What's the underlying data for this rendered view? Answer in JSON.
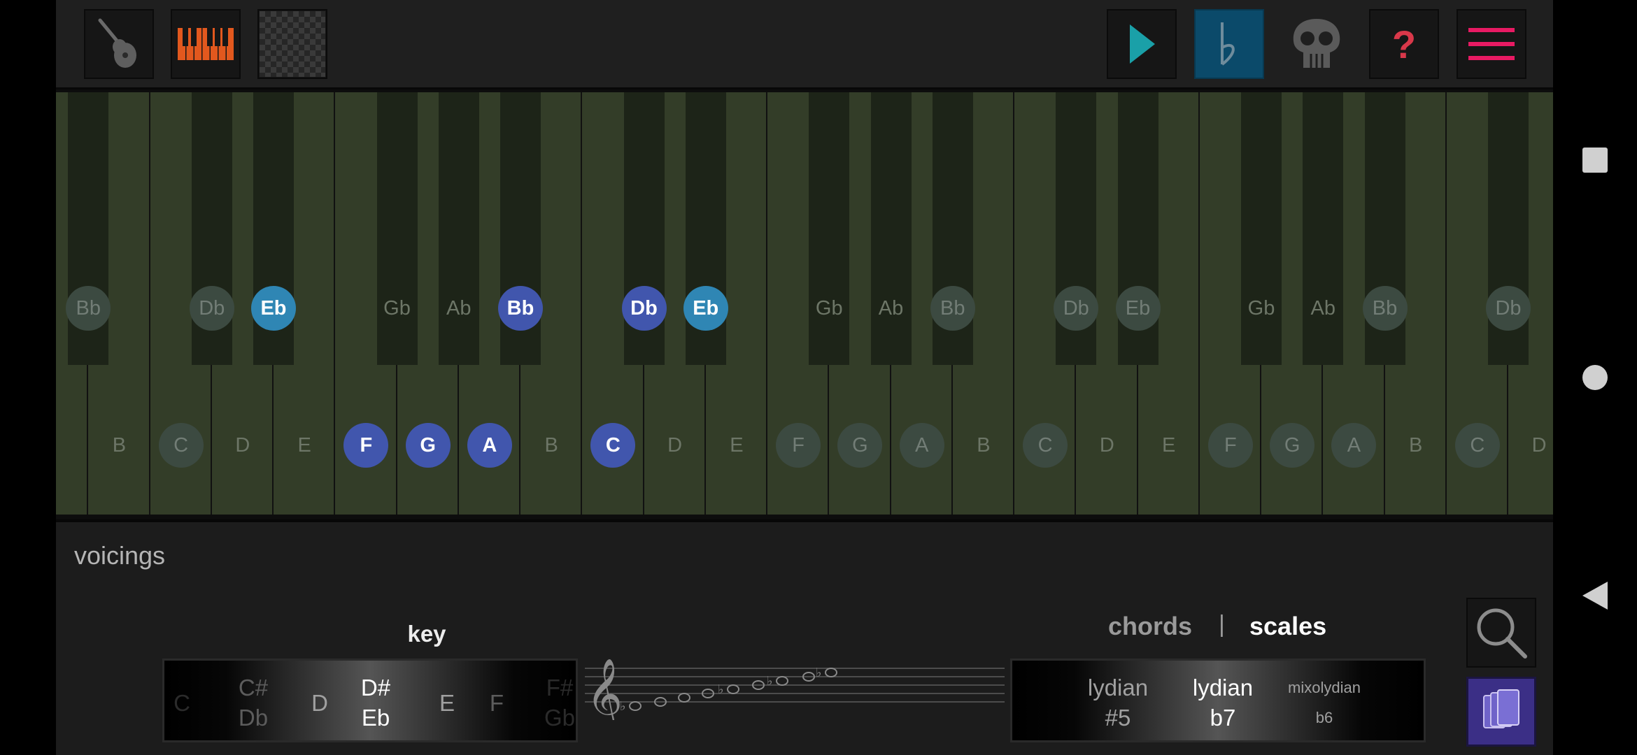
{
  "toolbar": {
    "left_buttons": [
      {
        "name": "guitar-icon",
        "selected": false
      },
      {
        "name": "piano-icon",
        "selected": false
      },
      {
        "name": "checkered-pattern-icon",
        "selected": false
      }
    ],
    "right_buttons": [
      {
        "name": "play-icon",
        "selected": false
      },
      {
        "name": "flat-symbol-icon",
        "selected": true
      },
      {
        "name": "skull-icon",
        "selected": false
      },
      {
        "name": "question-icon",
        "label": "?"
      },
      {
        "name": "menu-icon"
      }
    ]
  },
  "colors": {
    "highlight": "#4156ad",
    "root": "#2f86b4",
    "dim": "#3c4a41",
    "piano_icon": "#e2581e",
    "play": "#1aa0a8",
    "accent_pink": "#e81a63",
    "question": "#d9384a"
  },
  "keyboard": {
    "black_notes": [
      {
        "label": "Bb",
        "state": "dim"
      },
      {
        "label": "Db",
        "state": "dim"
      },
      {
        "label": "Eb",
        "state": "root"
      },
      {
        "label": "Gb",
        "state": "plain"
      },
      {
        "label": "Ab",
        "state": "plain"
      },
      {
        "label": "Bb",
        "state": "highlight"
      },
      {
        "label": "Db",
        "state": "highlight"
      },
      {
        "label": "Eb",
        "state": "root"
      },
      {
        "label": "Gb",
        "state": "plain"
      },
      {
        "label": "Ab",
        "state": "plain"
      },
      {
        "label": "Bb",
        "state": "dim"
      },
      {
        "label": "Db",
        "state": "dim"
      },
      {
        "label": "Eb",
        "state": "dim"
      },
      {
        "label": "Gb",
        "state": "plain"
      },
      {
        "label": "Ab",
        "state": "plain"
      },
      {
        "label": "Bb",
        "state": "dim"
      },
      {
        "label": "Db",
        "state": "dim"
      }
    ],
    "white_notes": [
      {
        "label": "B",
        "state": "plain"
      },
      {
        "label": "C",
        "state": "dim"
      },
      {
        "label": "D",
        "state": "plain"
      },
      {
        "label": "E",
        "state": "plain"
      },
      {
        "label": "F",
        "state": "highlight"
      },
      {
        "label": "G",
        "state": "highlight"
      },
      {
        "label": "A",
        "state": "highlight"
      },
      {
        "label": "B",
        "state": "plain"
      },
      {
        "label": "C",
        "state": "highlight"
      },
      {
        "label": "D",
        "state": "plain"
      },
      {
        "label": "E",
        "state": "plain"
      },
      {
        "label": "F",
        "state": "dim"
      },
      {
        "label": "G",
        "state": "dim"
      },
      {
        "label": "A",
        "state": "dim"
      },
      {
        "label": "B",
        "state": "plain"
      },
      {
        "label": "C",
        "state": "dim"
      },
      {
        "label": "D",
        "state": "plain"
      },
      {
        "label": "E",
        "state": "plain"
      },
      {
        "label": "F",
        "state": "dim"
      },
      {
        "label": "G",
        "state": "dim"
      },
      {
        "label": "A",
        "state": "dim"
      },
      {
        "label": "B",
        "state": "plain"
      },
      {
        "label": "C",
        "state": "dim"
      },
      {
        "label": "D",
        "state": "plain"
      }
    ]
  },
  "bottom": {
    "voicings_label": "voicings",
    "key_label": "key",
    "key_wheel": [
      {
        "lines": [
          "C"
        ],
        "level": "faint"
      },
      {
        "lines": [
          "C#",
          "Db"
        ],
        "level": "mid"
      },
      {
        "lines": [
          "D"
        ],
        "level": "near"
      },
      {
        "lines": [
          "D#",
          "Eb"
        ],
        "level": "selected"
      },
      {
        "lines": [
          "E"
        ],
        "level": "near"
      },
      {
        "lines": [
          "F"
        ],
        "level": "mid"
      },
      {
        "lines": [
          "F#",
          "Gb"
        ],
        "level": "faint"
      }
    ],
    "tabs": {
      "chords": "chords",
      "separator": "|",
      "scales": "scales"
    },
    "scale_wheel": [
      {
        "lines": [
          "lydian",
          "#5"
        ],
        "level": "near"
      },
      {
        "lines": [
          "lydian",
          "b7"
        ],
        "level": "selected"
      },
      {
        "lines": [
          "mixolydian",
          "b6"
        ],
        "level": "near"
      }
    ],
    "side_buttons": [
      "search-icon",
      "library-icon"
    ]
  },
  "navbar": [
    "square-icon",
    "circle-icon",
    "back-triangle-icon"
  ]
}
